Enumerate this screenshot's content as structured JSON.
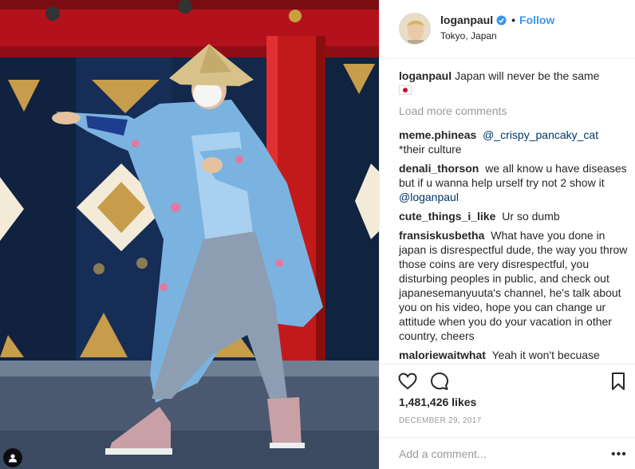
{
  "post": {
    "username": "loganpaul",
    "follow_label": "Follow",
    "location": "Tokyo, Japan",
    "caption": "Japan will never be the same",
    "caption_flag_icon": "japan-flag-icon",
    "load_more_label": "Load more comments",
    "comments": [
      {
        "user": "meme.phineas",
        "mention": "@_crispy_pancaky_cat",
        "text": "*their culture"
      },
      {
        "user": "denali_thorson",
        "text": "we all know u have diseases but if u wanna help urself try not 2 show it",
        "mention": "@loganpaul"
      },
      {
        "user": "cute_things_i_like",
        "text": "Ur so dumb"
      },
      {
        "user": "fransiskusbetha",
        "text": "What have you done in japan is disrespectful dude, the way you throw those coins are very disrespectful, you disturbing peoples in public, and check out japanesemanyuuta's channel, he's talk about you on his video, hope you can change ur attitude when you do your vacation in other country, cheers"
      },
      {
        "user": "maloriewaitwhat",
        "text": "Yeah it won't becuase"
      }
    ],
    "likes": "1,481,426 likes",
    "date": "DECEMBER 29, 2017",
    "comment_placeholder": "Add a comment...",
    "more_label": "•••"
  },
  "icons": {
    "like": "heart-icon",
    "comment": "comment-icon",
    "save": "bookmark-icon",
    "verified": "verified-badge-icon",
    "user_tag": "user-tag-icon"
  },
  "colors": {
    "link": "#3897f0",
    "mention": "#003569",
    "muted": "#999999",
    "text": "#262626"
  }
}
